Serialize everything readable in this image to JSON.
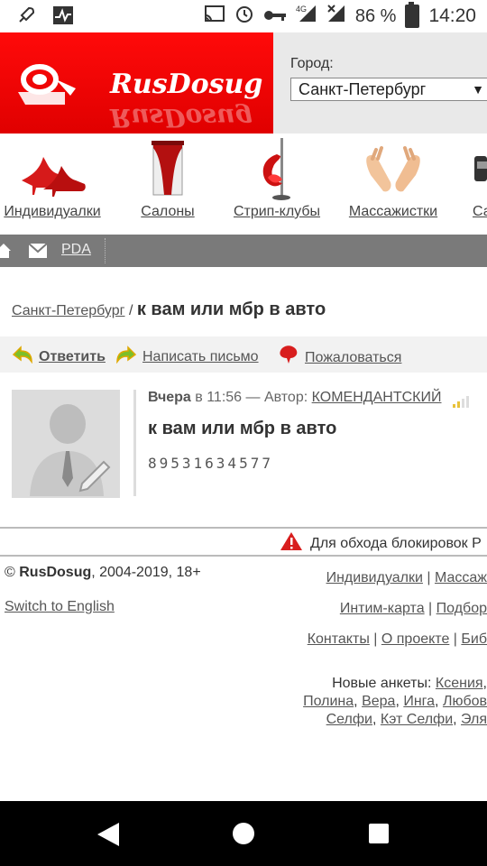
{
  "status_bar": {
    "battery": "86 %",
    "time": "14:20",
    "network": "4G"
  },
  "header": {
    "brand": "RusDosug",
    "city_label": "Город:",
    "city_value": "Санкт-Петербург"
  },
  "categories": [
    {
      "label": "Индивидуалки",
      "icon": "red-heels-icon"
    },
    {
      "label": "Салоны",
      "icon": "curtain-door-icon"
    },
    {
      "label": "Стрип-клубы",
      "icon": "pole-dance-icon"
    },
    {
      "label": "Массажистки",
      "icon": "massage-hands-icon"
    },
    {
      "label": "Са",
      "icon": "partial-category-icon"
    }
  ],
  "navbar": {
    "pda": "PDA"
  },
  "breadcrumb": {
    "city": "Санкт-Петербург",
    "separator": "/",
    "title": "к вам или мбр в авто"
  },
  "actions": {
    "reply": "Ответить",
    "write": "Написать письмо",
    "complain": "Пожаловаться"
  },
  "post": {
    "date": "Вчера",
    "time_prefix": "в 11:56 — Автор:",
    "author": "КОМЕНДАНТСКИЙ",
    "title": "к вам или мбр в авто",
    "phone": "89531634577"
  },
  "footer": {
    "warning": "Для обхода блокировок Р",
    "copyright_brand": "RusDosug",
    "copyright_rest": ", 2004-2019, 18+",
    "switch_lang": "Switch to English",
    "links_row1": [
      "Индивидуалки",
      "Массаж"
    ],
    "links_row2": [
      "Интим-карта",
      "Подбор"
    ],
    "links_row3": [
      "Контакты",
      "О проекте",
      "Биб"
    ],
    "new_label": "Новые анкеты:",
    "new_line1": [
      "Ксения",
      ""
    ],
    "new_line2": [
      "Полина",
      "Вера",
      "Инга",
      "Любов"
    ],
    "new_line3": [
      "Селфи",
      "Кэт Селфи",
      "Эля"
    ]
  }
}
